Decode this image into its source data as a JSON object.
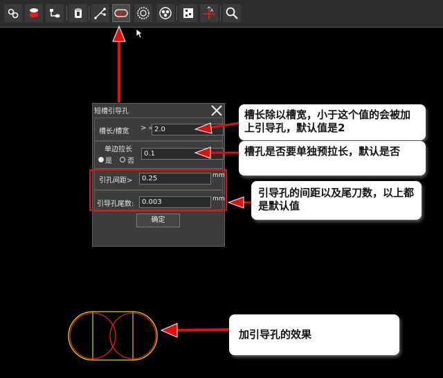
{
  "toolbar": {
    "buttons": [
      {
        "icon": "chain-link-icon"
      },
      {
        "icon": "ellipse-slot-icon"
      },
      {
        "icon": "node-connect-icon"
      },
      {
        "icon": "cylinder-icon"
      },
      {
        "icon": "branch-nodes-icon"
      },
      {
        "icon": "slot-hole-icon"
      },
      {
        "icon": "sawblade-icon"
      },
      {
        "icon": "triple-circle-icon"
      },
      {
        "icon": "tile-pattern-icon"
      },
      {
        "icon": "crosshair-measure-icon"
      },
      {
        "icon": "magnifier-icon"
      }
    ]
  },
  "dialog": {
    "title": "短槽引导孔",
    "row1": {
      "label": "槽长/槽宽",
      "prefix": "> =",
      "value": "2.0"
    },
    "row2": {
      "label": "单边拉长",
      "radio_yes": "是",
      "radio_no": "否",
      "value": "0.1"
    },
    "row3": {
      "label": "引孔间距>",
      "value": "0.25",
      "unit": "mm"
    },
    "row4": {
      "label": "引导孔尾数:",
      "value": "0.003",
      "unit": "mm"
    },
    "ok_label": "确定"
  },
  "callouts": {
    "c1": "槽长除以槽宽，小于这个值的会被加上引导孔，默认值是2",
    "c2": "槽孔是否要单独预拉长，默认是否",
    "c3": "引导孔的间距以及尾刀数，以上都是默认值",
    "c4": "加引导孔的效果"
  },
  "colors": {
    "arrow": "#e01010",
    "slot_outline": "#d8d800",
    "guide_hole": "#e02020",
    "toolbar_bg": "#2d2d2d",
    "dialog_bg": "#3c3c3c"
  }
}
